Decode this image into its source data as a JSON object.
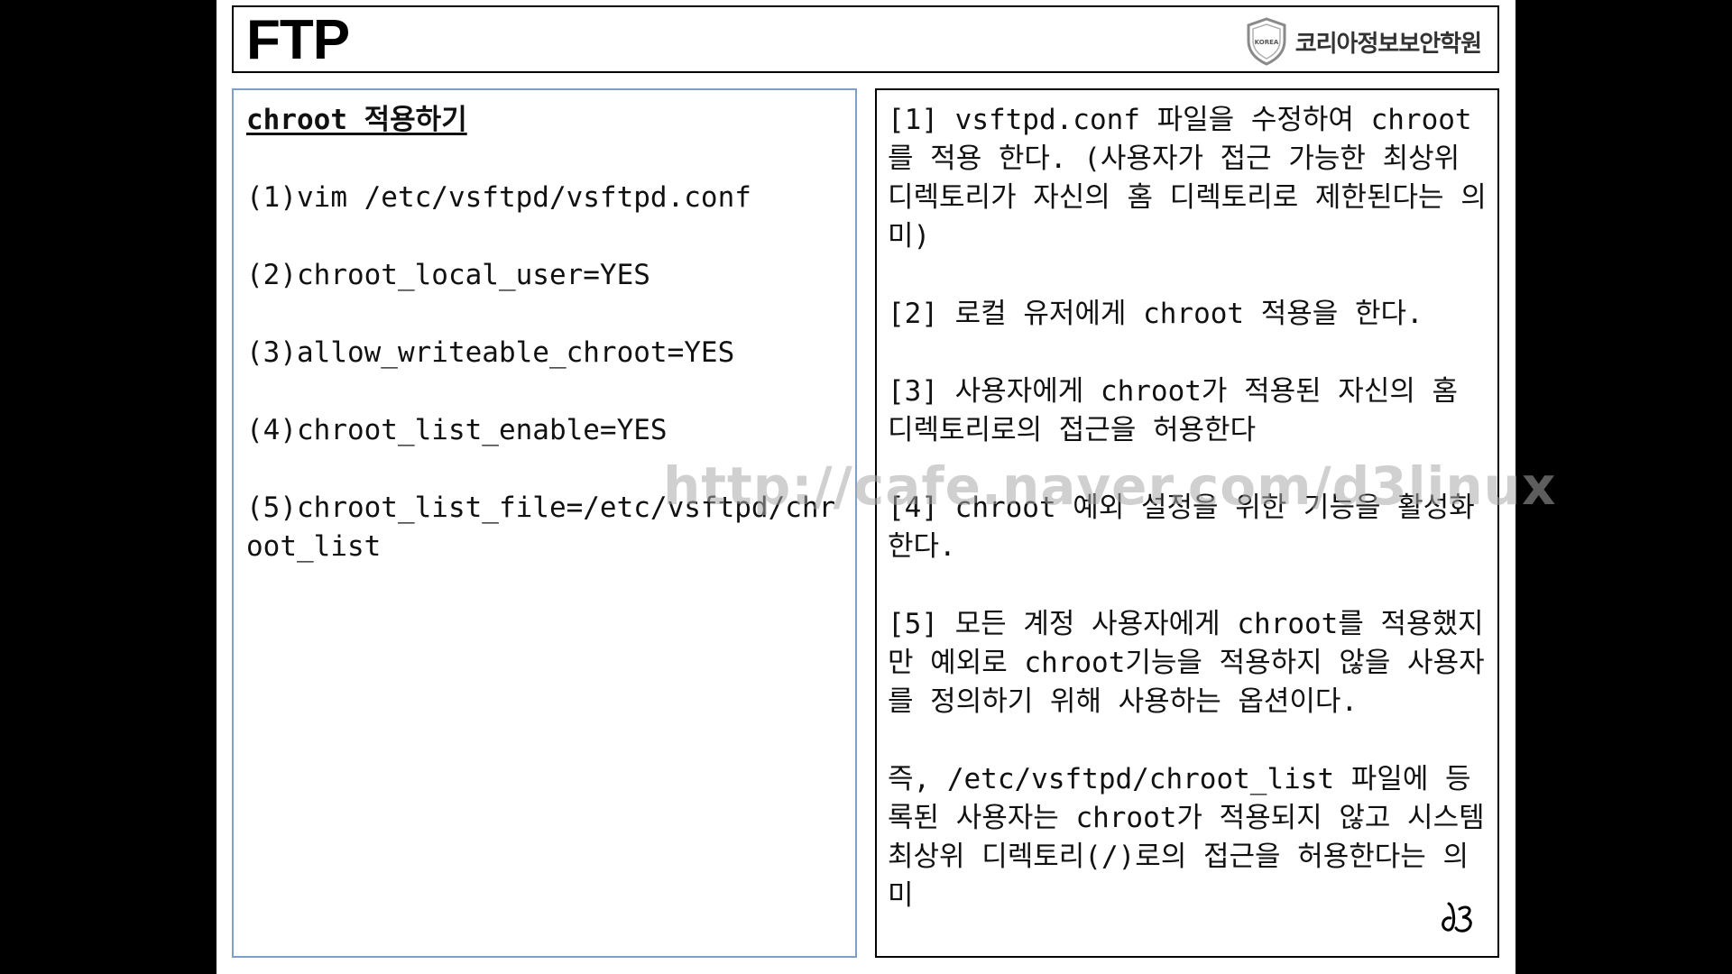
{
  "slide": {
    "title": "FTP",
    "logo": {
      "badge_text": "KOREA",
      "org_name": "코리아정보보안학원"
    },
    "left_panel": {
      "heading": "chroot 적용하기",
      "steps": [
        "(1)vim /etc/vsftpd/vsftpd.conf",
        "(2)chroot_local_user=YES",
        "(3)allow_writeable_chroot=YES",
        "(4)chroot_list_enable=YES",
        "(5)chroot_list_file=/etc/vsftpd/chroot_list"
      ]
    },
    "right_panel": {
      "notes": [
        "[1] vsftpd.conf 파일을 수정하여 chroot를 적용 한다. (사용자가 접근 가능한 최상위 디렉토리가 자신의 홈 디렉토리로 제한된다는 의미)",
        "[2] 로컬 유저에게 chroot 적용을 한다.",
        "[3] 사용자에게 chroot가 적용된 자신의 홈 디렉토리로의 접근을 허용한다",
        "[4] chroot 예외 설정을 위한 기능을 활성화한다.",
        "[5] 모든 계정 사용자에게 chroot를 적용했지만 예외로 chroot기능을 적용하지 않을 사용자를 정의하기 위해 사용하는 옵션이다.",
        "즉, /etc/vsftpd/chroot_list 파일에 등록된 사용자는 chroot가 적용되지 않고 시스템 최상위 디렉토리(/)로의 접근을 허용한다는 의미"
      ]
    },
    "watermark": "http://cafe.naver.com/d3linux"
  }
}
